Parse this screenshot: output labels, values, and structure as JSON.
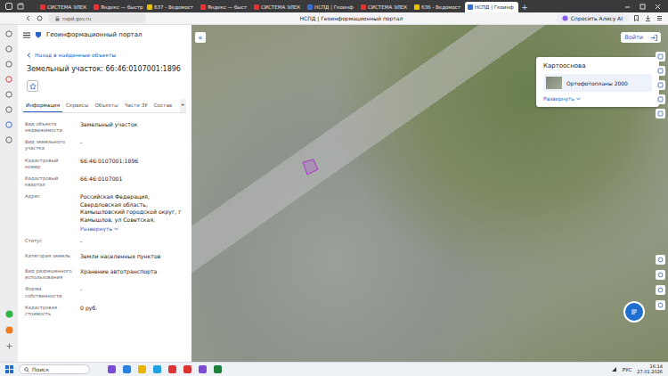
{
  "browser": {
    "tabs": [
      {
        "label": "СИСТЕМА ЭЛЕК",
        "selected": false
      },
      {
        "label": "Яндекс — быстр",
        "selected": false
      },
      {
        "label": "637 - Ведомост",
        "selected": false
      },
      {
        "label": "Яндекс — быст",
        "selected": false
      },
      {
        "label": "СИСТЕМА ЭЛЕК",
        "selected": false
      },
      {
        "label": "НСПД | Геоинф",
        "selected": false
      },
      {
        "label": "СИСТЕМА ЭЛЕК",
        "selected": false
      },
      {
        "label": "636 - Ведомост",
        "selected": false
      },
      {
        "label": "НСПД | Геоинф",
        "selected": true
      }
    ],
    "new_tab": "+",
    "url": "nspd.gov.ru",
    "page_title": "НСПД | Геоинформационный портал",
    "alice": "Спросить Алису AI"
  },
  "header": {
    "title": "Геоинформационный портал",
    "login": "Войти"
  },
  "panel": {
    "back": "Назад в найденные объекты",
    "title": "Земельный участок: 66:46:0107001:1896",
    "tabs": [
      {
        "label": "Информация",
        "selected": true
      },
      {
        "label": "Сервисы",
        "selected": false
      },
      {
        "label": "Объекты",
        "selected": false
      },
      {
        "label": "Части ЗУ",
        "selected": false
      },
      {
        "label": "Состав",
        "selected": false
      }
    ],
    "tabs_more": "▸",
    "fields": [
      {
        "label": "Вид объекта недвижимости",
        "value": "Земельный участок"
      },
      {
        "label": "Вид земельного участка",
        "value": "-"
      },
      {
        "label": "Кадастровый номер",
        "value": "66:46:0107001:1896"
      },
      {
        "label": "Кадастровый квартал",
        "value": "66:46:0107001"
      },
      {
        "label": "Адрес",
        "value": "Российская Федерация, Свердловская область, Камышловский городской округ, г Камышлов, ул Советская,",
        "link": "Развернуть"
      },
      {
        "label": "Статус",
        "value": "-"
      },
      {
        "label": "Категория земель",
        "value": "Земли населенных пунктов"
      },
      {
        "label": "Вид разрешенного использования",
        "value": "Хранение автотранспорта"
      },
      {
        "label": "Форма собственности",
        "value": "-"
      },
      {
        "label": "Кадастровая стоимость",
        "value": "0 руб."
      }
    ]
  },
  "map": {
    "collapse": "«",
    "basemap": {
      "title": "Картооснова",
      "layer": "Ортофотопланы 2000",
      "expand": "Развернуть"
    }
  },
  "taskbar": {
    "search": "Поиск",
    "lang": "РУС",
    "time": "16:14",
    "date": "27.01.2026"
  }
}
